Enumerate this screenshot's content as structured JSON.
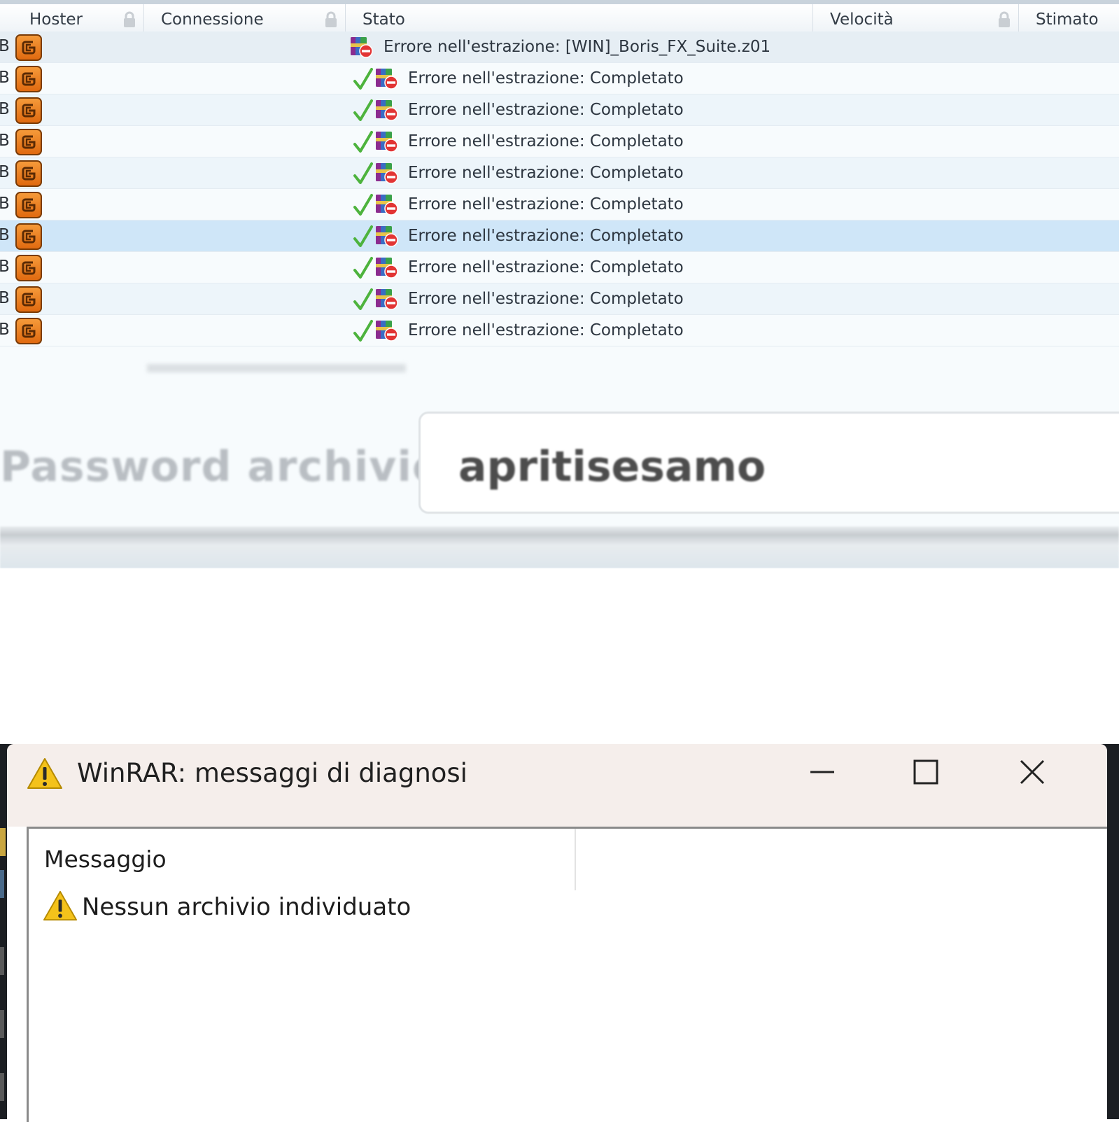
{
  "download_list": {
    "columns": {
      "hoster": "Hoster",
      "connection": "Connessione",
      "status": "Stato",
      "speed": "Velocità",
      "estimated": "Stimato"
    },
    "size_suffix": "B",
    "rows": [
      {
        "status": "Errore nell'estrazione: [WIN]_Boris_FX_Suite.z01",
        "check": false,
        "selected": false
      },
      {
        "status": "Errore nell'estrazione: Completato",
        "check": true,
        "selected": false
      },
      {
        "status": "Errore nell'estrazione: Completato",
        "check": true,
        "selected": false
      },
      {
        "status": "Errore nell'estrazione: Completato",
        "check": true,
        "selected": false
      },
      {
        "status": "Errore nell'estrazione: Completato",
        "check": true,
        "selected": false
      },
      {
        "status": "Errore nell'estrazione: Completato",
        "check": true,
        "selected": false
      },
      {
        "status": "Errore nell'estrazione: Completato",
        "check": true,
        "selected": true
      },
      {
        "status": "Errore nell'estrazione: Completato",
        "check": true,
        "selected": false
      },
      {
        "status": "Errore nell'estrazione: Completato",
        "check": true,
        "selected": false
      },
      {
        "status": "Errore nell'estrazione: Completato",
        "check": true,
        "selected": false
      }
    ]
  },
  "password": {
    "label": "Password archivio:",
    "value": "apritisesamo"
  },
  "dialog": {
    "title": "WinRAR: messaggi di diagnosi",
    "column_header": "Messaggio",
    "messages": [
      "Nessun archivio individuato"
    ]
  },
  "colors": {
    "row_selected": "#cfe6f8",
    "row_alt": "#edf5fa",
    "hoster_orange": "#ef7d1e",
    "check_green": "#4db33d",
    "warning_yellow": "#f4c21b"
  },
  "icons": {
    "hoster": "hoster-icon",
    "check": "check-icon",
    "archive_error": "rar-error-icon",
    "warning": "warning-icon",
    "minimize": "minimize-icon",
    "maximize": "maximize-icon",
    "close": "close-icon",
    "lock": "lock-icon"
  }
}
